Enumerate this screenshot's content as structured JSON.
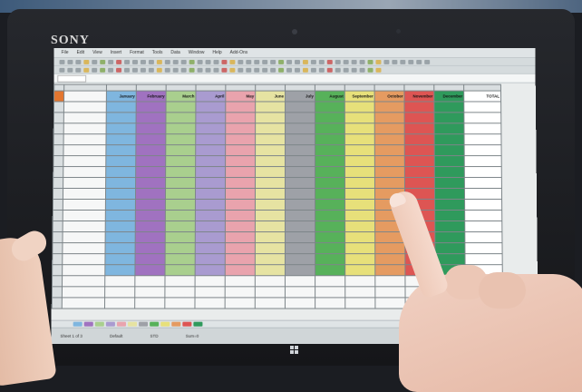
{
  "device": {
    "brand": "SONY"
  },
  "menu": {
    "items": [
      "File",
      "Edit",
      "View",
      "Insert",
      "Format",
      "Tools",
      "Data",
      "Window",
      "Help",
      "Add-Ons"
    ]
  },
  "sheet": {
    "total_header": "TOTAL",
    "months": [
      {
        "name": "January",
        "color": "#7fb6df"
      },
      {
        "name": "February",
        "color": "#a072c0"
      },
      {
        "name": "March",
        "color": "#a9cf8e"
      },
      {
        "name": "April",
        "color": "#a99bd0"
      },
      {
        "name": "May",
        "color": "#e9a3ad"
      },
      {
        "name": "June",
        "color": "#e6e3a2"
      },
      {
        "name": "July",
        "color": "#9ea1a7"
      },
      {
        "name": "August",
        "color": "#57b15a"
      },
      {
        "name": "September",
        "color": "#e7e07a"
      },
      {
        "name": "October",
        "color": "#e59b61"
      },
      {
        "name": "November",
        "color": "#dd5553"
      },
      {
        "name": "December",
        "color": "#2f9a5c"
      }
    ]
  },
  "status": {
    "items": [
      "Sheet 1 of 3",
      "Default",
      "STD",
      "Sum=0"
    ]
  },
  "colors": {
    "corner": "#e3762f",
    "screen_bg": "#e9ecec"
  }
}
